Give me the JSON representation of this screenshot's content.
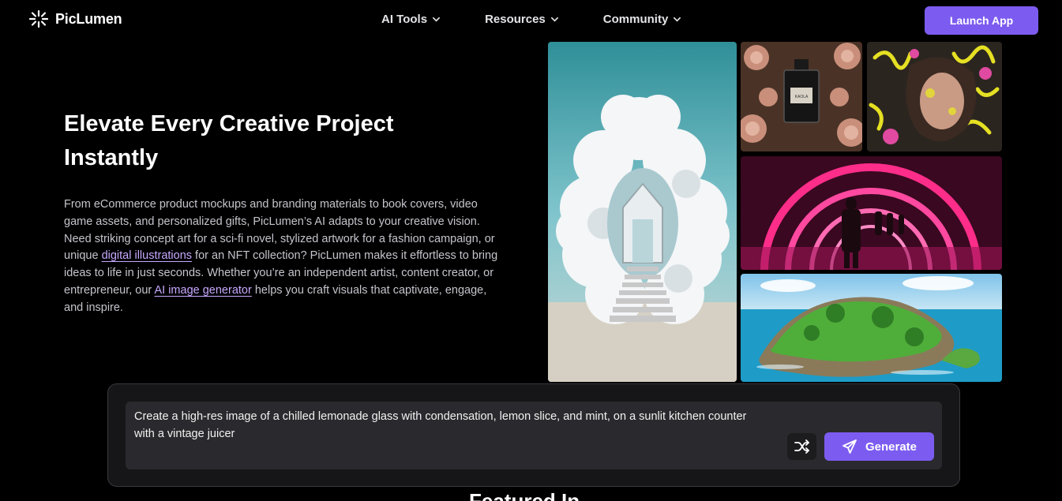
{
  "header": {
    "brand": "PicLumen",
    "nav": [
      {
        "label": "AI Tools"
      },
      {
        "label": "Resources"
      },
      {
        "label": "Community"
      }
    ],
    "launch_label": "Launch App",
    "accent": "#7c5cf0"
  },
  "hero": {
    "title": "Elevate Every Creative Project Instantly",
    "body_1": "From eCommerce product mockups and branding materials to book covers, video game assets, and personalized gifts, PicLumen’s AI adapts to your creative vision. Need striking concept art for a sci-fi novel, stylized artwork for a fashion campaign, or unique ",
    "link_1": "digital illustrations",
    "body_2": " for an NFT collection? PicLumen makes it effortless to bring ideas to life in just seconds. Whether you’re an independent artist, content creator, or entrepreneur, our ",
    "link_2": "AI image generator",
    "body_3": " helps you craft visuals that captivate, engage, and inspire."
  },
  "gallery": [
    {
      "icon": "cloud-portal-image"
    },
    {
      "icon": "perfume-roses-image",
      "bottle_label": "KAOLA"
    },
    {
      "icon": "graffiti-portrait-image"
    },
    {
      "icon": "neon-tunnel-image"
    },
    {
      "icon": "tropical-island-image"
    }
  ],
  "prompt": {
    "text": "Create a high-res image of a chilled lemonade glass with condensation, lemon slice, and mint, on a sunlit kitchen counter with a vintage juicer",
    "shuffle_icon": "shuffle-icon",
    "generate_label": "Generate",
    "generate_icon": "send-icon"
  },
  "next_section": {
    "heading_partial": "Featured In"
  }
}
